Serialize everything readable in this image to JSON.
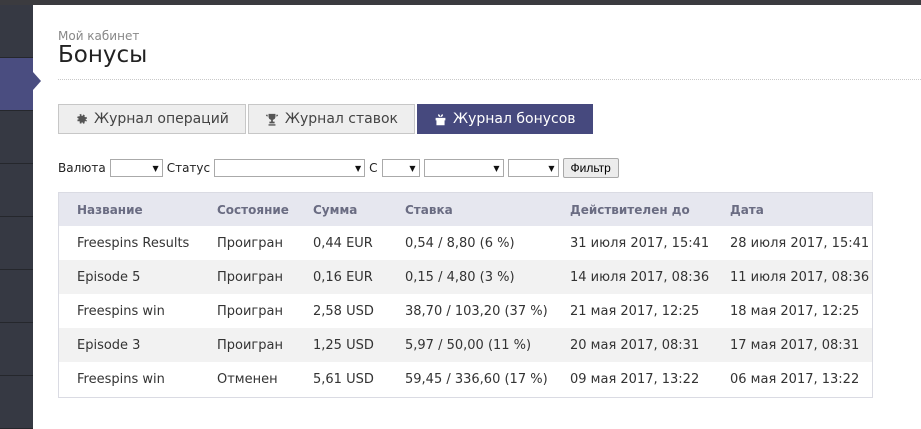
{
  "header": {
    "breadcrumb": "Мой кабинет",
    "title": "Бонусы"
  },
  "tabs": [
    {
      "label": "Журнал операций",
      "icon": "gear-icon",
      "active": false
    },
    {
      "label": "Журнал ставок",
      "icon": "trophy-icon",
      "active": false
    },
    {
      "label": "Журнал бонусов",
      "icon": "gift-icon",
      "active": true
    }
  ],
  "filters": {
    "currency_label": "Валюта",
    "currency_value": "",
    "status_label": "Статус",
    "status_value": "",
    "from_label": "С",
    "day_value": "",
    "month_value": "",
    "year_value": "",
    "filter_button": "Фильтр"
  },
  "table": {
    "columns": [
      "Название",
      "Состояние",
      "Сумма",
      "Ставка",
      "Действителен до",
      "Дата"
    ],
    "rows": [
      [
        "Freespins Results",
        "Проигран",
        "0,44 EUR",
        "0,54 / 8,80 (6 %)",
        "31 июля 2017, 15:41",
        "28 июля 2017, 15:41"
      ],
      [
        "Episode 5",
        "Проигран",
        "0,16 EUR",
        "0,15 / 4,80 (3 %)",
        "14 июля 2017, 08:36",
        "11 июля 2017, 08:36"
      ],
      [
        "Freespins win",
        "Проигран",
        "2,58 USD",
        "38,70 / 103,20 (37 %)",
        "21 мая 2017, 12:25",
        "18 мая 2017, 12:25"
      ],
      [
        "Episode 3",
        "Проигран",
        "1,25 USD",
        "5,97 / 50,00 (11 %)",
        "20 мая 2017, 08:31",
        "17 мая 2017, 08:31"
      ],
      [
        "Freespins win",
        "Отменен",
        "5,61 USD",
        "59,45 / 336,60 (17 %)",
        "09 мая 2017, 13:22",
        "06 мая 2017, 13:22"
      ]
    ]
  },
  "colors": {
    "accent": "#46497e",
    "sidebar": "#2e3037"
  }
}
